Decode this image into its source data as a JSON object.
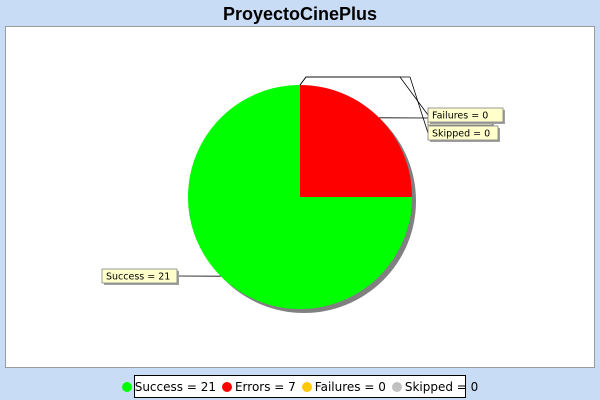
{
  "chart_data": {
    "type": "pie",
    "title": "ProyectoCinePlus",
    "slices": [
      {
        "label": "Success = 21",
        "name": "Success",
        "value": 21,
        "color": "#00ff00",
        "label_side": "left"
      },
      {
        "label": "Errors = 7",
        "name": "Errors",
        "value": 7,
        "color": "#ff0000",
        "label_side": "right"
      },
      {
        "label": "Failures = 0",
        "name": "Failures",
        "value": 0,
        "color": "#ffc800",
        "label_side": "right"
      },
      {
        "label": "Skipped = 0",
        "name": "Skipped",
        "value": 0,
        "color": "#c0c0c0",
        "label_side": "right"
      }
    ],
    "legend_position": "bottom",
    "background_color": "#c8dcf6",
    "label_box_color": "#ffffcc",
    "shadow_color": "#808080"
  }
}
